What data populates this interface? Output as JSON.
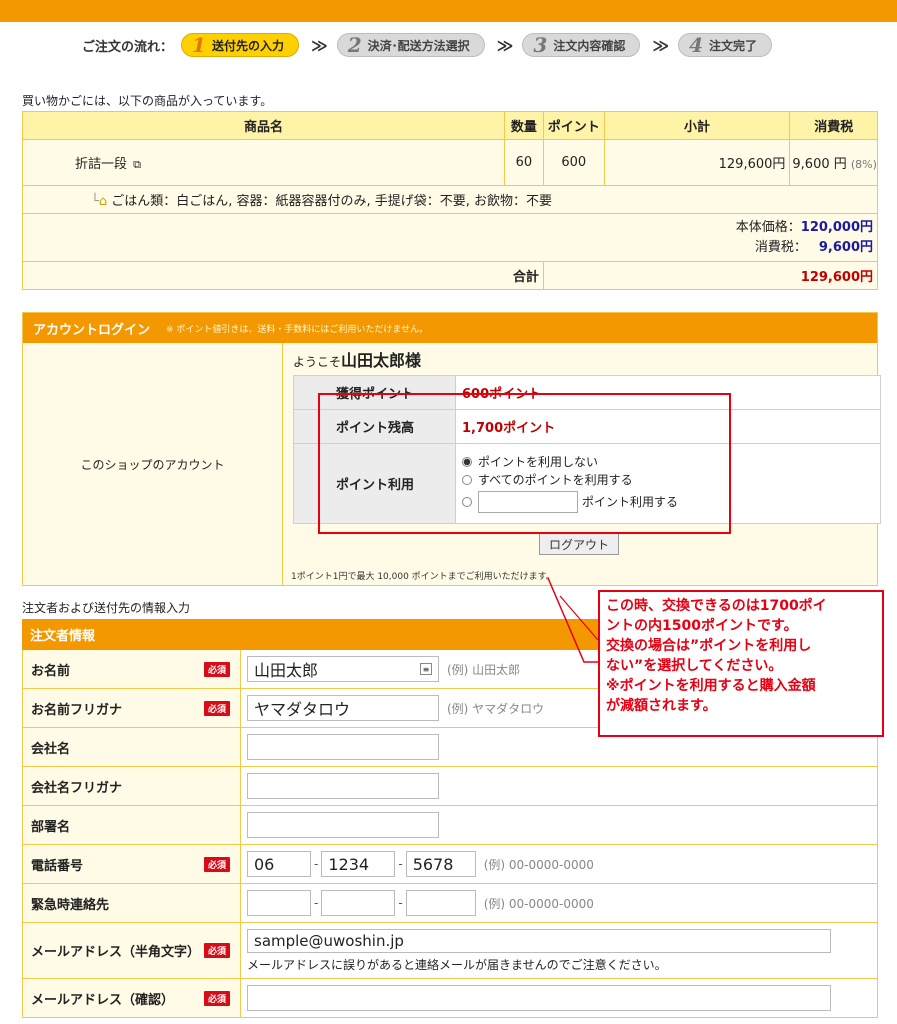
{
  "steps": {
    "flow_label": "ご注文の流れ：",
    "items": [
      {
        "num": "1",
        "label": "送付先の入力"
      },
      {
        "num": "2",
        "label": "決済･配送方法選択"
      },
      {
        "num": "3",
        "label": "注文内容確認"
      },
      {
        "num": "4",
        "label": "注文完了"
      }
    ],
    "arrow": "≫"
  },
  "cart": {
    "caption": "買い物かごには、以下の商品が入っています。",
    "headers": [
      "商品名",
      "数量",
      "ポイント",
      "小計",
      "消費税"
    ],
    "product": {
      "name": "折詰一段",
      "qty": "60",
      "points": "600",
      "subtotal": "129,600円",
      "tax": "9,600 円",
      "tax_rate": "(8%)"
    },
    "options": "ごはん類：白ごはん, 容器：紙器容器付のみ, 手提げ袋：不要, お飲物：不要",
    "base_label": "本体価格：",
    "base_value": "120,000円",
    "tax_label": "消費税：",
    "tax_value": "9,600円",
    "total_label": "合計",
    "total_value": "129,600円"
  },
  "account": {
    "title": "アカウントログイン",
    "note": "※ ポイント値引きは、送料・手数料にはご利用いただけません。",
    "left_label": "このショップのアカウント",
    "welcome_prefix": "ようこそ",
    "user_name": "山田太郎様",
    "earned_label": "獲得ポイント",
    "earned_value": "600ポイント",
    "balance_label": "ポイント残高",
    "balance_value": "1,700ポイント",
    "use_label": "ポイント利用",
    "opt_none": "ポイントを利用しない",
    "opt_all": "すべてのポイントを利用する",
    "opt_custom": "ポイント利用する",
    "logout": "ログアウト",
    "footnote": "1ポイント1円で最大 10,000 ポイントまでご利用いただけます。"
  },
  "callout": {
    "lines": [
      "この時、交換できるのは1700ポイ",
      "ントの内1500ポイントです。",
      "交換の場合は”ポイントを利用し",
      "ない”を選択してください。",
      "※ポイントを利用すると購入金額",
      "が減額されます。"
    ]
  },
  "customer": {
    "caption": "注文者および送付先の情報入力",
    "title": "注文者情報",
    "required": "必須",
    "name_label": "お名前",
    "name_value": "山田太郎",
    "name_hint": "(例) 山田太郎",
    "kana_label": "お名前フリガナ",
    "kana_value": "ヤマダタロウ",
    "kana_hint": "(例) ヤマダタロウ",
    "company_label": "会社名",
    "company_kana_label": "会社名フリガナ",
    "dept_label": "部署名",
    "tel_label": "電話番号",
    "tel_1": "06",
    "tel_2": "1234",
    "tel_3": "5678",
    "tel_hint": "(例) 00-0000-0000",
    "emergency_label": "緊急時連絡先",
    "emergency_hint": "(例) 00-0000-0000",
    "email_label": "メールアドレス（半角文字）",
    "email_value": "sample@uwoshin.jp",
    "email_note": "メールアドレスに誤りがあると連絡メールが届きませんのでご注意ください。",
    "email_confirm_label": "メールアドレス（確認）"
  }
}
